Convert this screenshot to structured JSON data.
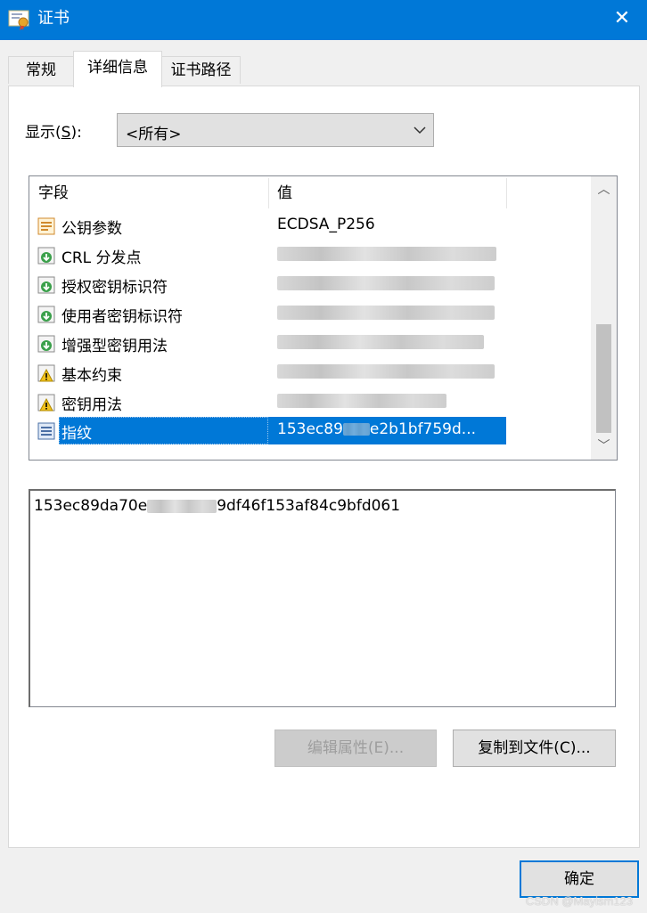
{
  "window": {
    "title": "证书",
    "close_glyph": "✕"
  },
  "tabs": [
    {
      "label": "常规",
      "active": false
    },
    {
      "label": "详细信息",
      "active": true
    },
    {
      "label": "证书路径",
      "active": false
    }
  ],
  "show": {
    "label_prefix": "显示(",
    "label_key": "S",
    "label_suffix": "):",
    "selected": "<所有>"
  },
  "list": {
    "columns": [
      "字段",
      "值"
    ],
    "rows": [
      {
        "field": "公钥参数",
        "value": "ECDSA_P256",
        "icon": "certificate-field-icon",
        "selected": false
      },
      {
        "field": "CRL 分发点",
        "value": "",
        "icon": "extension-icon",
        "selected": false
      },
      {
        "field": "授权密钥标识符",
        "value": "",
        "icon": "extension-icon",
        "selected": false
      },
      {
        "field": "使用者密钥标识符",
        "value": "",
        "icon": "extension-icon",
        "selected": false
      },
      {
        "field": "增强型密钥用法",
        "value": "",
        "icon": "extension-icon",
        "selected": false
      },
      {
        "field": "基本约束",
        "value": "",
        "icon": "critical-extension-icon",
        "selected": false
      },
      {
        "field": "密钥用法",
        "value": "",
        "icon": "critical-extension-icon",
        "selected": false
      },
      {
        "field": "指纹",
        "value_start": "153ec89",
        "value_end": "e2b1bf759d...",
        "icon": "property-icon",
        "selected": true
      }
    ]
  },
  "detail": {
    "value_start": "153ec89da70e",
    "value_end": "9df46f153af84c9bfd061"
  },
  "buttons": {
    "edit_properties": {
      "label": "编辑属性(E)...",
      "enabled": false
    },
    "copy_to_file": {
      "label": "复制到文件(C)..."
    },
    "ok": {
      "label": "确定"
    }
  },
  "watermark": "CSDN @Mayism123",
  "colors": {
    "titlebar": "#0078d7",
    "selection": "#0078d7"
  }
}
